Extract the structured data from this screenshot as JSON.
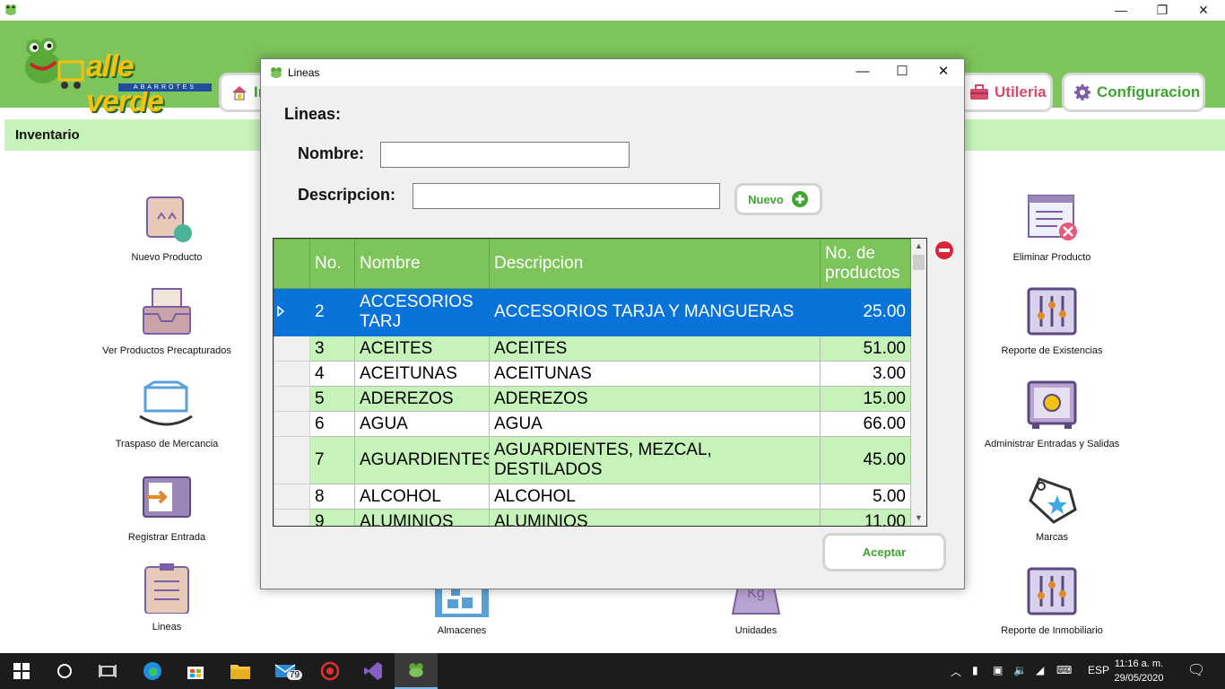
{
  "window": {
    "minimize": "—",
    "restore": "❐",
    "close": "✕"
  },
  "header": {
    "brand": "alle verde",
    "brand_sub": "ABARROTES",
    "nav": [
      {
        "label": "In",
        "icon": "home-icon"
      },
      {
        "label": "Utileria",
        "icon": "toolbox-icon"
      },
      {
        "label": "Configuracion",
        "icon": "gear-icon"
      }
    ]
  },
  "section": {
    "title": "Inventario"
  },
  "tiles": {
    "nuevo_producto": "Nuevo Producto",
    "ver_precapturados": "Ver Productos Precapturados",
    "traspaso": "Traspaso de Mercancia",
    "registrar_entrada": "Registrar Entrada",
    "lineas": "Lineas",
    "almacenes": "Almacenes",
    "unidades": "Unidades",
    "eliminar_producto": "Eliminar Producto",
    "reporte_existencias": "Reporte de Existencias",
    "administrar_es": "Administrar Entradas y Salidas",
    "marcas": "Marcas",
    "reporte_inmobiliario": "Reporte de Inmobiliario"
  },
  "dialog": {
    "title": "Lineas",
    "heading": "Lineas:",
    "nombre_label": "Nombre:",
    "nombre_value": "",
    "descripcion_label": "Descripcion:",
    "descripcion_value": "",
    "nuevo_label": "Nuevo",
    "aceptar_label": "Aceptar",
    "grid": {
      "headers": [
        "No.",
        "Nombre",
        "Descripcion",
        "No. de productos"
      ],
      "rows": [
        {
          "no": "2",
          "nombre": "ACCESORIOS TARJ",
          "descripcion": "ACCESORIOS TARJA Y MANGUERAS",
          "productos": "25.00",
          "selected": true
        },
        {
          "no": "3",
          "nombre": "ACEITES",
          "descripcion": "ACEITES",
          "productos": "51.00"
        },
        {
          "no": "4",
          "nombre": "ACEITUNAS",
          "descripcion": "ACEITUNAS",
          "productos": "3.00"
        },
        {
          "no": "5",
          "nombre": "ADEREZOS",
          "descripcion": "ADEREZOS",
          "productos": "15.00"
        },
        {
          "no": "6",
          "nombre": "AGUA",
          "descripcion": "AGUA",
          "productos": "66.00"
        },
        {
          "no": "7",
          "nombre": "AGUARDIENTES",
          "descripcion": "AGUARDIENTES, MEZCAL, DESTILADOS",
          "productos": "45.00"
        },
        {
          "no": "8",
          "nombre": "ALCOHOL",
          "descripcion": "ALCOHOL",
          "productos": "5.00"
        },
        {
          "no": "9",
          "nombre": "ALUMINIOS",
          "descripcion": "ALUMINIOS",
          "productos": "11.00"
        }
      ]
    }
  },
  "taskbar": {
    "mail_badge": "79",
    "language": "ESP",
    "time": "11:16 a. m.",
    "date": "29/05/2020"
  },
  "colors": {
    "brand_green": "#7dc45a",
    "light_green": "#c6f3b9",
    "selection_blue": "#0a73d9",
    "nav_text_green": "#3fa531",
    "utileria_pink": "#d94b6a",
    "remove_red": "#d72638"
  }
}
